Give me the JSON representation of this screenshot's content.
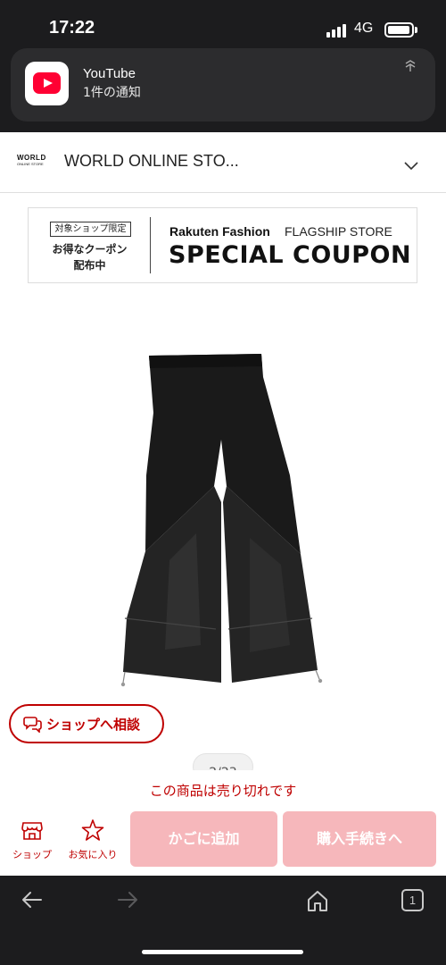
{
  "status_bar": {
    "time": "17:22",
    "network": "4G"
  },
  "notification": {
    "app": "YouTube",
    "text": "1件の通知"
  },
  "shop": {
    "logo_line1": "WORLD",
    "logo_line2": "ONLINE STORE",
    "title": "WORLD ONLINE STO..."
  },
  "coupon": {
    "tag": "対象ショップ限定",
    "line2": "お得なクーポン",
    "line3": "配布中",
    "brand": "Rakuten Fashion",
    "store": "FLAGSHIP STORE",
    "main": "SPECIAL COUPON"
  },
  "product": {
    "image_icon": "black-wide-pants-image"
  },
  "consult": {
    "label": "ショップへ相談"
  },
  "pager": {
    "text": "2/23"
  },
  "action_bar": {
    "soldout": "この商品は売り切れです",
    "shop_label": "ショップ",
    "fav_label": "お気に入り",
    "cart_label": "かごに追加",
    "buy_label": "購入手続きへ"
  },
  "browser": {
    "tab_count": "1"
  },
  "colors": {
    "accent": "#bf0000",
    "disabled_button": "#f6b7bb",
    "dark_bar": "#1c1c1e"
  }
}
